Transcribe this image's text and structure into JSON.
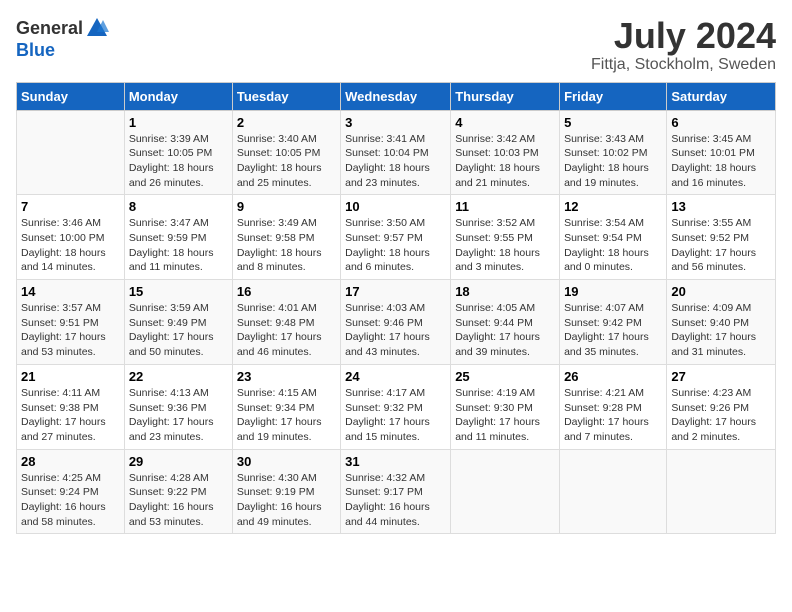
{
  "header": {
    "logo_general": "General",
    "logo_blue": "Blue",
    "title": "July 2024",
    "subtitle": "Fittja, Stockholm, Sweden"
  },
  "columns": [
    "Sunday",
    "Monday",
    "Tuesday",
    "Wednesday",
    "Thursday",
    "Friday",
    "Saturday"
  ],
  "weeks": [
    [
      {
        "day": "",
        "info": ""
      },
      {
        "day": "1",
        "info": "Sunrise: 3:39 AM\nSunset: 10:05 PM\nDaylight: 18 hours\nand 26 minutes."
      },
      {
        "day": "2",
        "info": "Sunrise: 3:40 AM\nSunset: 10:05 PM\nDaylight: 18 hours\nand 25 minutes."
      },
      {
        "day": "3",
        "info": "Sunrise: 3:41 AM\nSunset: 10:04 PM\nDaylight: 18 hours\nand 23 minutes."
      },
      {
        "day": "4",
        "info": "Sunrise: 3:42 AM\nSunset: 10:03 PM\nDaylight: 18 hours\nand 21 minutes."
      },
      {
        "day": "5",
        "info": "Sunrise: 3:43 AM\nSunset: 10:02 PM\nDaylight: 18 hours\nand 19 minutes."
      },
      {
        "day": "6",
        "info": "Sunrise: 3:45 AM\nSunset: 10:01 PM\nDaylight: 18 hours\nand 16 minutes."
      }
    ],
    [
      {
        "day": "7",
        "info": "Sunrise: 3:46 AM\nSunset: 10:00 PM\nDaylight: 18 hours\nand 14 minutes."
      },
      {
        "day": "8",
        "info": "Sunrise: 3:47 AM\nSunset: 9:59 PM\nDaylight: 18 hours\nand 11 minutes."
      },
      {
        "day": "9",
        "info": "Sunrise: 3:49 AM\nSunset: 9:58 PM\nDaylight: 18 hours\nand 8 minutes."
      },
      {
        "day": "10",
        "info": "Sunrise: 3:50 AM\nSunset: 9:57 PM\nDaylight: 18 hours\nand 6 minutes."
      },
      {
        "day": "11",
        "info": "Sunrise: 3:52 AM\nSunset: 9:55 PM\nDaylight: 18 hours\nand 3 minutes."
      },
      {
        "day": "12",
        "info": "Sunrise: 3:54 AM\nSunset: 9:54 PM\nDaylight: 18 hours\nand 0 minutes."
      },
      {
        "day": "13",
        "info": "Sunrise: 3:55 AM\nSunset: 9:52 PM\nDaylight: 17 hours\nand 56 minutes."
      }
    ],
    [
      {
        "day": "14",
        "info": "Sunrise: 3:57 AM\nSunset: 9:51 PM\nDaylight: 17 hours\nand 53 minutes."
      },
      {
        "day": "15",
        "info": "Sunrise: 3:59 AM\nSunset: 9:49 PM\nDaylight: 17 hours\nand 50 minutes."
      },
      {
        "day": "16",
        "info": "Sunrise: 4:01 AM\nSunset: 9:48 PM\nDaylight: 17 hours\nand 46 minutes."
      },
      {
        "day": "17",
        "info": "Sunrise: 4:03 AM\nSunset: 9:46 PM\nDaylight: 17 hours\nand 43 minutes."
      },
      {
        "day": "18",
        "info": "Sunrise: 4:05 AM\nSunset: 9:44 PM\nDaylight: 17 hours\nand 39 minutes."
      },
      {
        "day": "19",
        "info": "Sunrise: 4:07 AM\nSunset: 9:42 PM\nDaylight: 17 hours\nand 35 minutes."
      },
      {
        "day": "20",
        "info": "Sunrise: 4:09 AM\nSunset: 9:40 PM\nDaylight: 17 hours\nand 31 minutes."
      }
    ],
    [
      {
        "day": "21",
        "info": "Sunrise: 4:11 AM\nSunset: 9:38 PM\nDaylight: 17 hours\nand 27 minutes."
      },
      {
        "day": "22",
        "info": "Sunrise: 4:13 AM\nSunset: 9:36 PM\nDaylight: 17 hours\nand 23 minutes."
      },
      {
        "day": "23",
        "info": "Sunrise: 4:15 AM\nSunset: 9:34 PM\nDaylight: 17 hours\nand 19 minutes."
      },
      {
        "day": "24",
        "info": "Sunrise: 4:17 AM\nSunset: 9:32 PM\nDaylight: 17 hours\nand 15 minutes."
      },
      {
        "day": "25",
        "info": "Sunrise: 4:19 AM\nSunset: 9:30 PM\nDaylight: 17 hours\nand 11 minutes."
      },
      {
        "day": "26",
        "info": "Sunrise: 4:21 AM\nSunset: 9:28 PM\nDaylight: 17 hours\nand 7 minutes."
      },
      {
        "day": "27",
        "info": "Sunrise: 4:23 AM\nSunset: 9:26 PM\nDaylight: 17 hours\nand 2 minutes."
      }
    ],
    [
      {
        "day": "28",
        "info": "Sunrise: 4:25 AM\nSunset: 9:24 PM\nDaylight: 16 hours\nand 58 minutes."
      },
      {
        "day": "29",
        "info": "Sunrise: 4:28 AM\nSunset: 9:22 PM\nDaylight: 16 hours\nand 53 minutes."
      },
      {
        "day": "30",
        "info": "Sunrise: 4:30 AM\nSunset: 9:19 PM\nDaylight: 16 hours\nand 49 minutes."
      },
      {
        "day": "31",
        "info": "Sunrise: 4:32 AM\nSunset: 9:17 PM\nDaylight: 16 hours\nand 44 minutes."
      },
      {
        "day": "",
        "info": ""
      },
      {
        "day": "",
        "info": ""
      },
      {
        "day": "",
        "info": ""
      }
    ]
  ]
}
